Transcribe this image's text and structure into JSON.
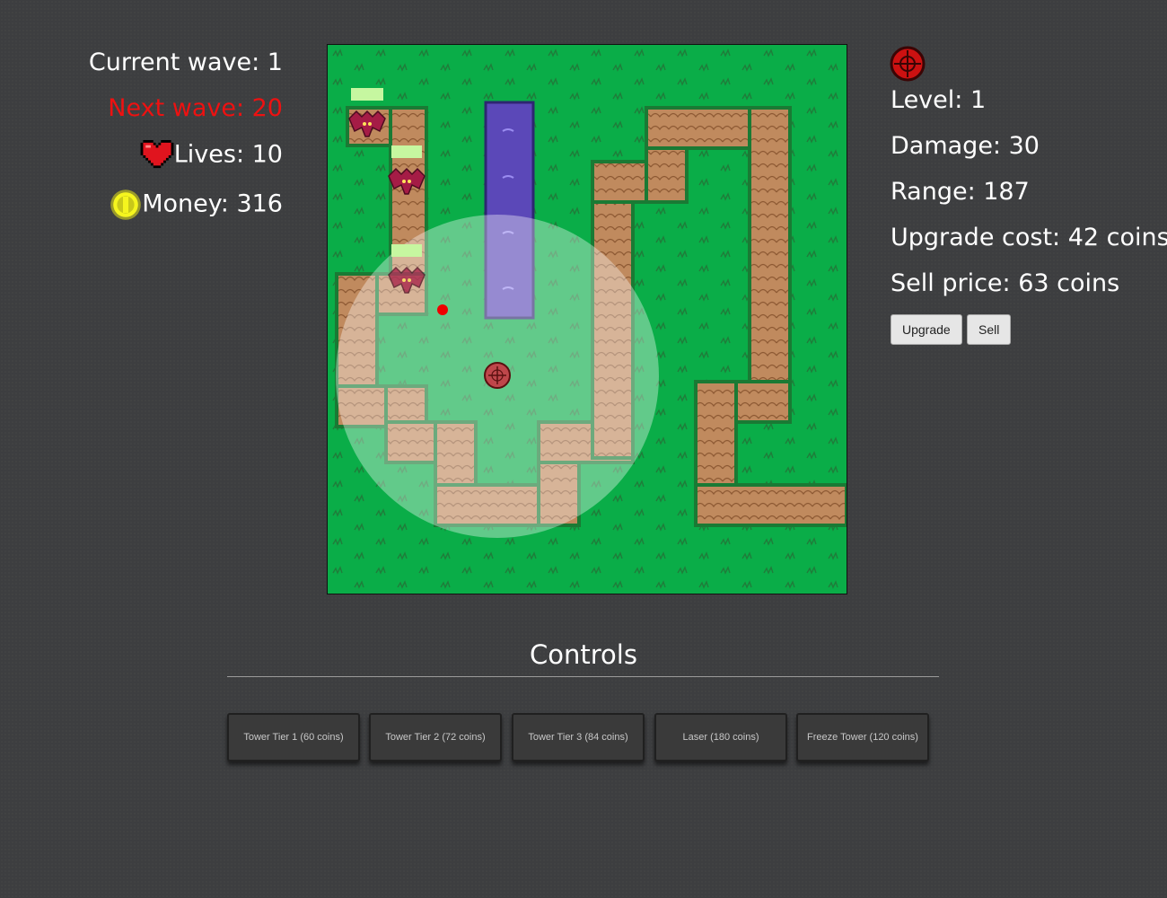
{
  "hud": {
    "current_wave": "Current wave: 1",
    "next_wave": "Next wave: 20",
    "lives": "Lives: 10",
    "money": "Money: 316"
  },
  "tower_info": {
    "level": "Level: 1",
    "damage": "Damage: 30",
    "range": "Range: 187",
    "upgrade_cost": "Upgrade cost: 42 coins",
    "sell_price": "Sell price: 63 coins",
    "upgrade_label": "Upgrade",
    "sell_label": "Sell"
  },
  "controls": {
    "title": "Controls",
    "buttons": [
      "Tower Tier 1 (60 coins)",
      "Tower Tier 2 (72 coins)",
      "Tower Tier 3 (84 coins)",
      "Laser (180 coins)",
      "Freeze Tower (120 coins)"
    ]
  },
  "colors": {
    "grass": "#0aad48",
    "path": "#c08a5e",
    "water": "#5b48b8",
    "next_wave": "#ee1111",
    "health_bar": "#c6f7a0",
    "enemy": "#a51c46"
  },
  "icons": [
    "heart-icon",
    "coin-icon",
    "tower-icon",
    "bat-enemy-icon"
  ]
}
